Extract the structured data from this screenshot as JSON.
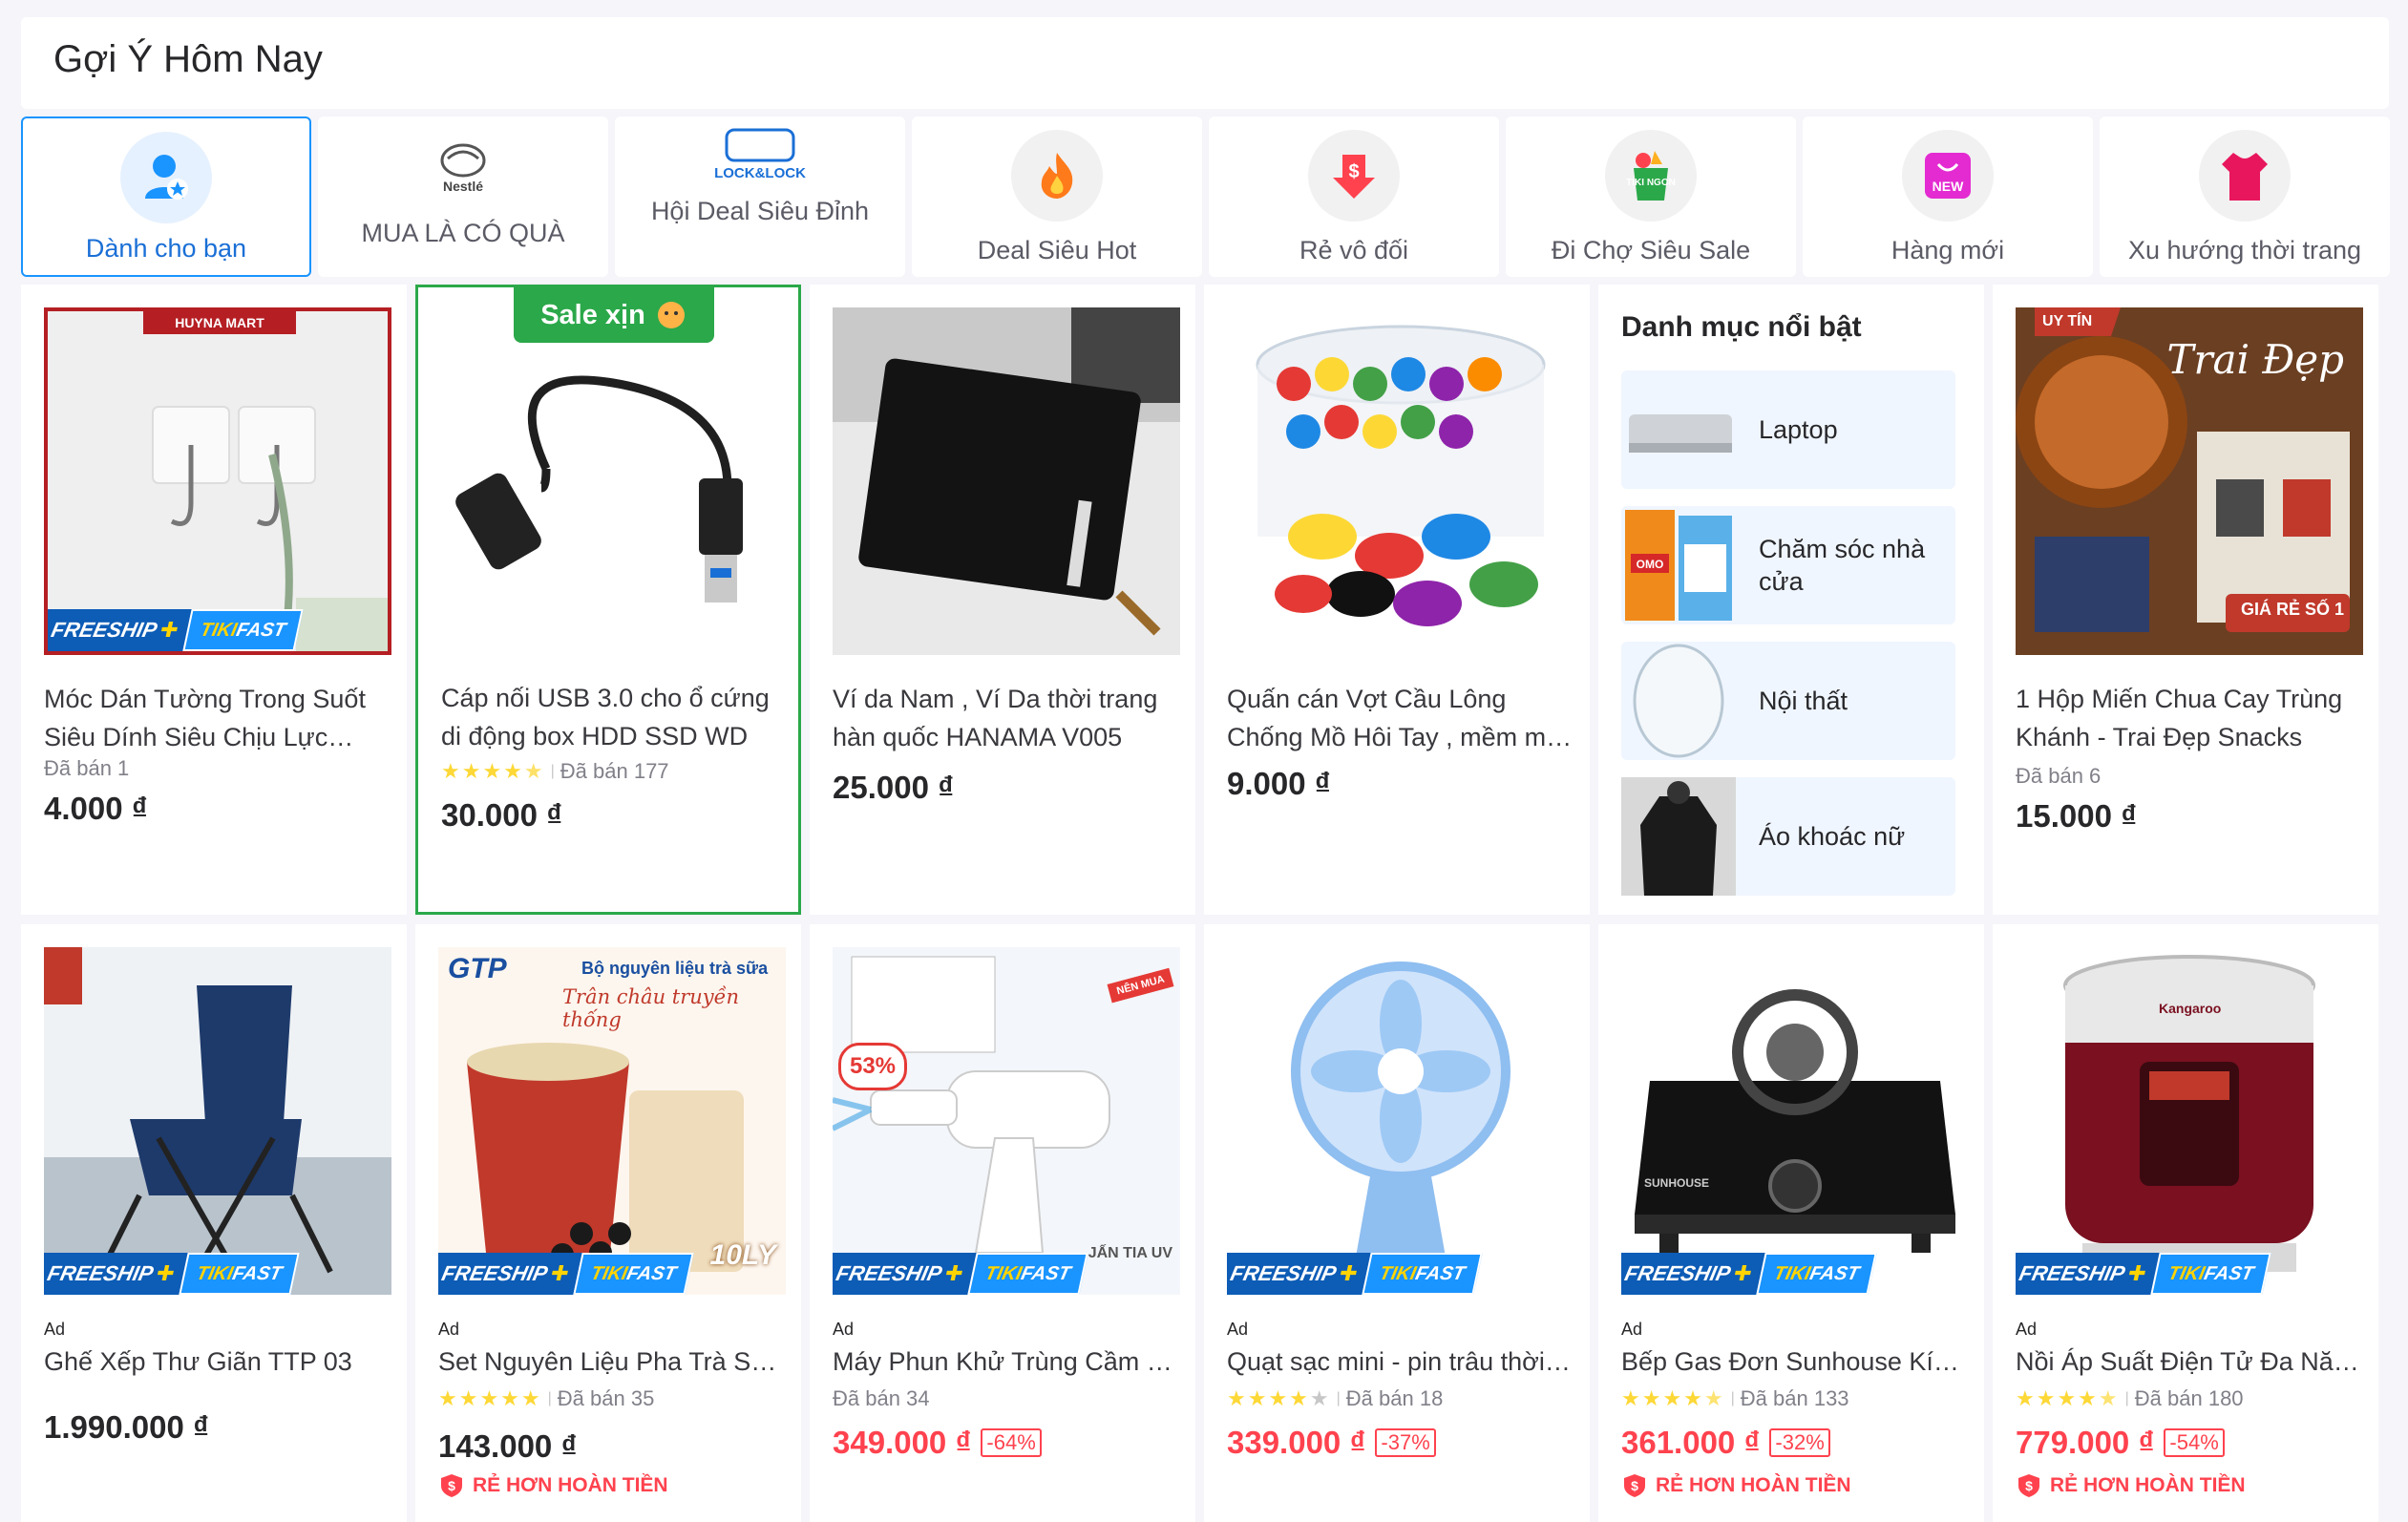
{
  "header": {
    "title": "Gợi Ý Hôm Nay"
  },
  "tabs": [
    {
      "label": "Dành cho bạn",
      "icon": "person-star-icon"
    },
    {
      "label": "MUA LÀ CÓ QUÀ",
      "icon": "nestle-logo",
      "brand": "Nestlé"
    },
    {
      "label": "Hội Deal Siêu Đỉnh",
      "icon": "locknlock-logo",
      "brand": "LOCK&LOCK"
    },
    {
      "label": "Deal Siêu Hot",
      "icon": "fire-icon"
    },
    {
      "label": "Rẻ vô đối",
      "icon": "price-down-icon"
    },
    {
      "label": "Đi Chợ Siêu Sale",
      "icon": "grocery-bag-icon",
      "brand": "TIKI NGON"
    },
    {
      "label": "Hàng mới",
      "icon": "new-bag-icon",
      "brand": "NEW"
    },
    {
      "label": "Xu hướng thời trang",
      "icon": "shirt-icon"
    }
  ],
  "badges": {
    "freeship": "FREESHIP",
    "tikifast_a": "TIKI",
    "tikifast_b": "FAST",
    "sale_xin": "Sale xịn",
    "guarantee": "RẺ HƠN HOÀN TIỀN",
    "ad": "Ad"
  },
  "row1": [
    {
      "name": "Móc Dán Tường Trong Suốt Siêu Dính Siêu Chịu Lực Huyna Mart",
      "sold": "Đã bán 1",
      "price": "4.000 ₫",
      "store_tag": "HUYNA MART"
    },
    {
      "name": "Cáp nối USB 3.0 cho ổ cứng di động box HDD SSD WD",
      "rating": 4.5,
      "sold": "Đã bán 177",
      "price": "30.000 ₫"
    },
    {
      "name": "Ví da Nam , Ví Da thời trang hàn quốc HANAMA V005",
      "price": "25.000 ₫"
    },
    {
      "name": "Quấn cán Vợt Cầu Lông Chống Mồ Hôi Tay , mềm mại , dày dặn",
      "price": "9.000 ₫"
    },
    {
      "name": "1 Hộp Miến Chua Cay Trùng Khánh - Trai Đẹp Snacks",
      "sold": "Đã bán 6",
      "price": "15.000 ₫",
      "overlay_a": "UY TÍN",
      "overlay_b": "Trai Đẹp",
      "overlay_c": "GIÁ RẺ SỐ 1"
    }
  ],
  "categories": {
    "title": "Danh mục nổi bật",
    "items": [
      {
        "label": "Laptop"
      },
      {
        "label": "Chăm sóc nhà cửa"
      },
      {
        "label": "Nội thất"
      },
      {
        "label": "Áo khoác nữ"
      }
    ]
  },
  "row2": [
    {
      "name": "Ghế Xếp Thư Giãn TTP 03",
      "price": "1.990.000 ₫"
    },
    {
      "name": "Set Nguyên Liệu Pha Trà Sữa Trân Châu",
      "rating": 5,
      "sold": "Đã bán 35",
      "price": "143.000 ₫",
      "img_a": "GTP",
      "img_b": "Bộ nguyên liệu trà sữa",
      "img_c": "Trân châu truyền thống",
      "img_d": "10LY"
    },
    {
      "name": "Máy Phun Khử Trùng Cầm Ứng Tia UV",
      "sold": "Đã bán 34",
      "price": "349.000 ₫",
      "discount": "-64%",
      "img_a": "53%",
      "img_b": "NÊN MUA",
      "img_c": "JẤN TIA UV"
    },
    {
      "name": "Quạt sạc mini - pin trâu thời trang",
      "rating": 4,
      "sold": "Đã bán 18",
      "price": "339.000 ₫",
      "discount": "-37%"
    },
    {
      "name": "Bếp Gas Đơn Sunhouse Kính Cường Lực",
      "rating": 4.5,
      "sold": "Đã bán 133",
      "price": "361.000 ₫",
      "discount": "-32%",
      "img_a": "SUNHOUSE"
    },
    {
      "name": "Nồi Áp Suất Điện Tử Đa Năng Kangaroo",
      "rating": 4.5,
      "sold": "Đã bán 180",
      "price": "779.000 ₫",
      "discount": "-54%",
      "img_a": "Kangaroo"
    }
  ],
  "colors": {
    "accent": "#1a94ff",
    "sale": "#ff424e",
    "featured": "#2ba84a",
    "freeship": "#0d5cb6"
  }
}
